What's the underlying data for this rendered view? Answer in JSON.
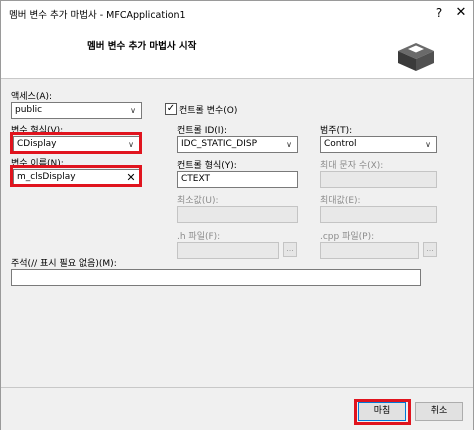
{
  "window": {
    "title": "멤버 변수 추가 마법사 - MFCApplication1",
    "help_glyph": "?",
    "close_glyph": "✕"
  },
  "header": {
    "title": "멤버 변수 추가 마법사 시작",
    "icon": "wizard-box-icon"
  },
  "form": {
    "access": {
      "label": "액세스(A):",
      "value": "public"
    },
    "control_var": {
      "label": "컨트롤 변수(O)",
      "checked": true
    },
    "var_type": {
      "label": "변수 형식(V):",
      "value": "CDisplay"
    },
    "control_id": {
      "label": "컨트롤 ID(I):",
      "value": "IDC_STATIC_DISP"
    },
    "category": {
      "label": "범주(T):",
      "value": "Control"
    },
    "var_name": {
      "label": "변수 이름(N):",
      "value": "m_clsDisplay",
      "clear_glyph": "✕"
    },
    "control_type": {
      "label": "컨트롤 형식(Y):",
      "value": "CTEXT"
    },
    "max_chars": {
      "label": "최대 문자 수(X):",
      "value": ""
    },
    "min_value": {
      "label": "최소값(U):",
      "value": ""
    },
    "max_value": {
      "label": "최대값(E):",
      "value": ""
    },
    "h_file": {
      "label": ".h 파일(F):",
      "value": "",
      "browse": "..."
    },
    "cpp_file": {
      "label": ".cpp 파일(P):",
      "value": "",
      "browse": "..."
    },
    "comment": {
      "label": "주석(// 표시 필요 없음)(M):",
      "value": ""
    }
  },
  "footer": {
    "finish_label": "마침",
    "cancel_label": "취소"
  },
  "colors": {
    "highlight": "#e0141e",
    "dialog_bg": "#f0f0f0"
  }
}
